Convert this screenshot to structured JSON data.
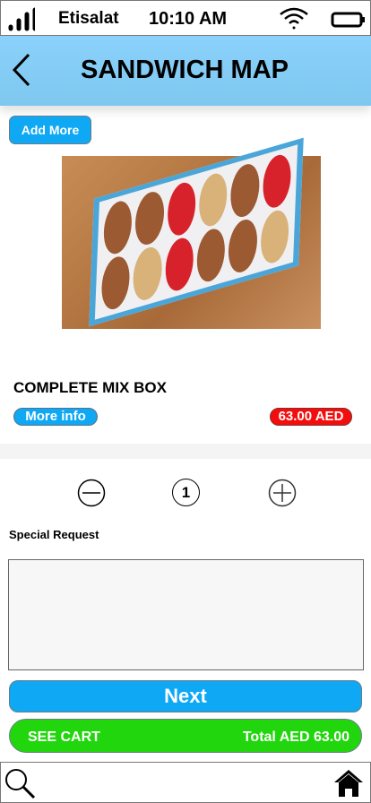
{
  "status": {
    "carrier": "Etisalat",
    "time": "10:10 AM",
    "icons": [
      "signal-icon",
      "wifi-icon",
      "battery-icon"
    ]
  },
  "header": {
    "title": "SANDWICH MAP",
    "back_icon": "chevron-left-icon"
  },
  "add_more_label": "Add More",
  "product": {
    "name": "COMPLETE MIX BOX",
    "more_info_label": "More info",
    "price": "63.00 AED"
  },
  "quantity": {
    "value": "1",
    "decrement_icon": "minus-circle-icon",
    "increment_icon": "plus-circle-icon"
  },
  "special_request": {
    "label": "Special Request",
    "value": ""
  },
  "next_label": "Next",
  "cart": {
    "label": "SEE CART",
    "total": "Total AED 63.00"
  },
  "colors": {
    "header": "#85cdf6",
    "primary": "#0ea8f5",
    "price": "#f50d0d",
    "cart": "#22d60e"
  },
  "tabbar": {
    "icons": [
      "search-icon",
      "home-icon"
    ]
  }
}
